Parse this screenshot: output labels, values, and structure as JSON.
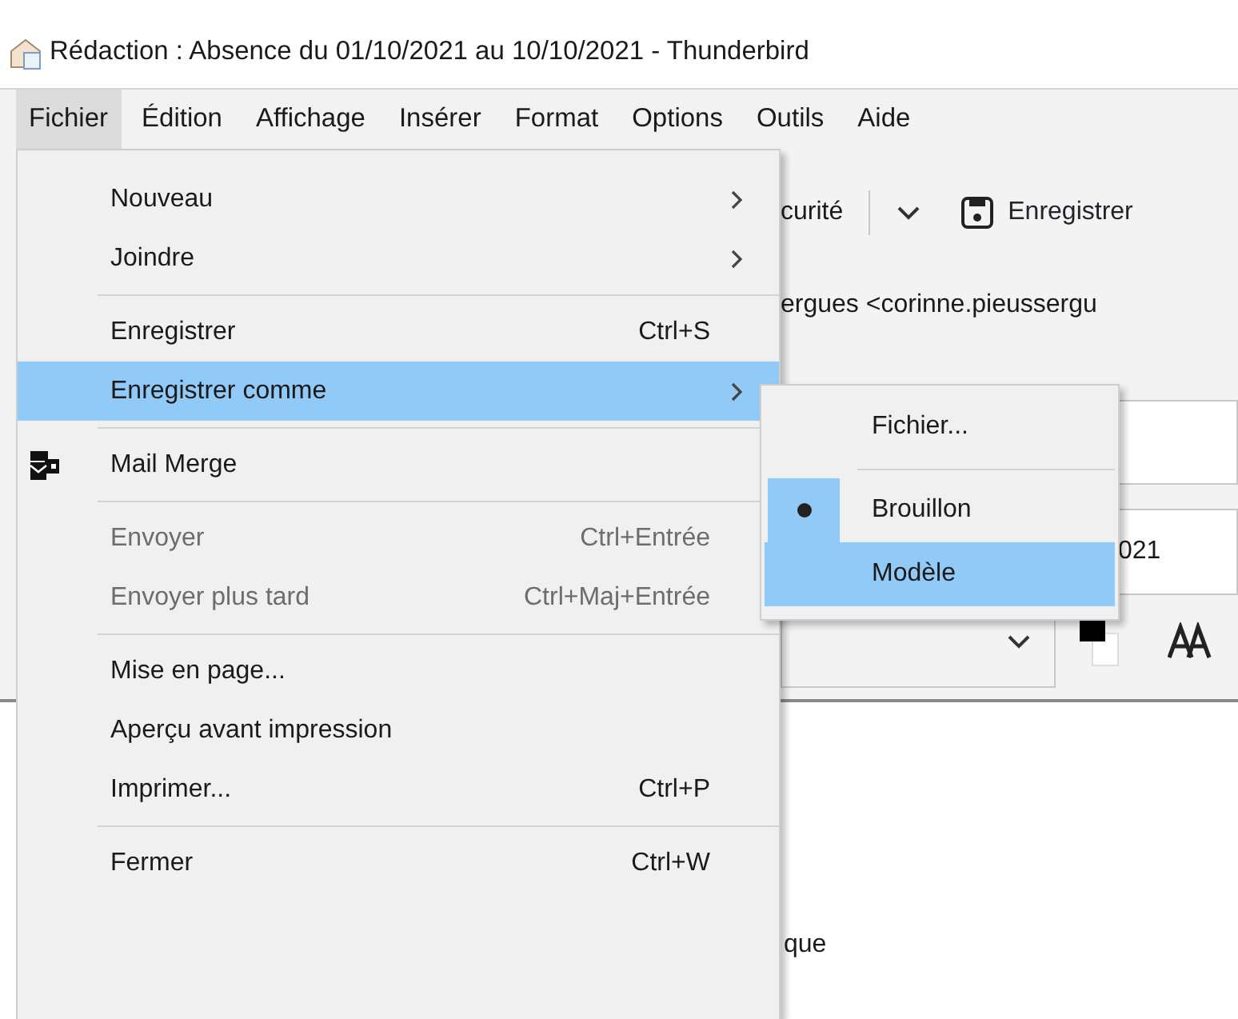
{
  "window": {
    "title": "Rédaction : Absence du 01/10/2021 au 10/10/2021 - Thunderbird"
  },
  "menubar": [
    {
      "label": "Fichier",
      "selected": true
    },
    {
      "label": "Édition",
      "selected": false
    },
    {
      "label": "Affichage",
      "selected": false
    },
    {
      "label": "Insérer",
      "selected": false
    },
    {
      "label": "Format",
      "selected": false
    },
    {
      "label": "Options",
      "selected": false
    },
    {
      "label": "Outils",
      "selected": false
    },
    {
      "label": "Aide",
      "selected": false
    }
  ],
  "compose": {
    "security_label": "curité",
    "save_button": "Enregistrer",
    "from_text": "ergues <corinne.pieussergu",
    "date_field": "021",
    "body_text": "que"
  },
  "menu": {
    "items": [
      {
        "kind": "item",
        "label": "Nouveau",
        "submenu": true,
        "disabled": false,
        "selected": false
      },
      {
        "kind": "item",
        "label": "Joindre",
        "submenu": true,
        "disabled": false,
        "selected": false
      },
      {
        "kind": "separator"
      },
      {
        "kind": "item",
        "label": "Enregistrer",
        "shortcut": "Ctrl+S",
        "submenu": false,
        "disabled": false,
        "selected": false
      },
      {
        "kind": "item",
        "label": "Enregistrer comme",
        "submenu": true,
        "disabled": false,
        "selected": true
      },
      {
        "kind": "separator"
      },
      {
        "kind": "icon_item",
        "label": "Mail Merge",
        "submenu": false,
        "disabled": false,
        "selected": false
      },
      {
        "kind": "separator"
      },
      {
        "kind": "item",
        "label": "Envoyer",
        "shortcut": "Ctrl+Entrée",
        "submenu": false,
        "disabled": true,
        "selected": false
      },
      {
        "kind": "item",
        "label": "Envoyer plus tard",
        "shortcut": "Ctrl+Maj+Entrée",
        "submenu": false,
        "disabled": true,
        "selected": false
      },
      {
        "kind": "separator"
      },
      {
        "kind": "item",
        "label": "Mise en page...",
        "submenu": false,
        "disabled": false,
        "selected": false
      },
      {
        "kind": "item",
        "label": "Aperçu avant impression",
        "submenu": false,
        "disabled": false,
        "selected": false
      },
      {
        "kind": "item",
        "label": "Imprimer...",
        "shortcut": "Ctrl+P",
        "submenu": false,
        "disabled": false,
        "selected": false
      },
      {
        "kind": "separator"
      },
      {
        "kind": "item",
        "label": "Fermer",
        "shortcut": "Ctrl+W",
        "submenu": false,
        "disabled": false,
        "selected": false
      }
    ]
  },
  "submenu": {
    "items": [
      {
        "kind": "item",
        "label": "Fichier...",
        "selected": false
      },
      {
        "kind": "separator"
      },
      {
        "kind": "radio",
        "label": "Brouillon",
        "checked": true,
        "selected": false
      },
      {
        "kind": "radio",
        "label": "Modèle",
        "checked": false,
        "selected": true
      }
    ]
  }
}
